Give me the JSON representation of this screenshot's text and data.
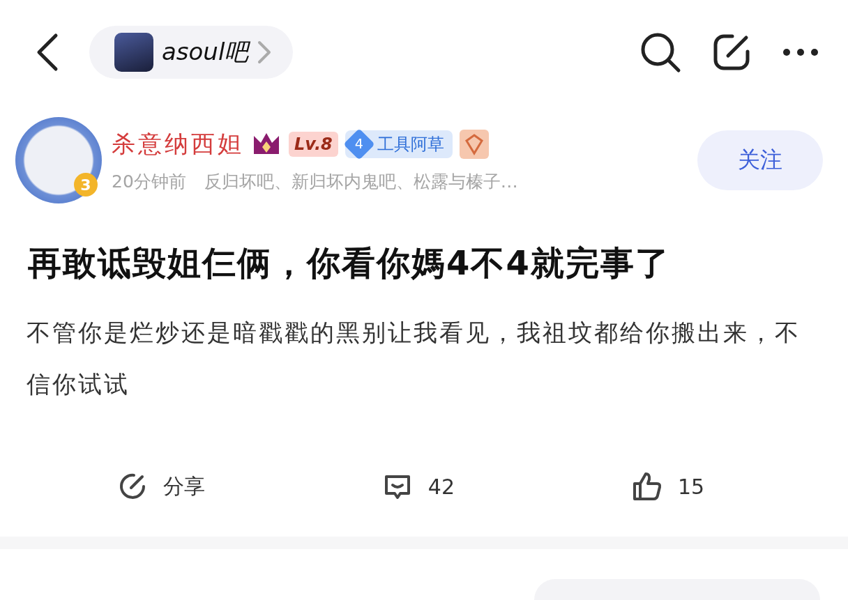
{
  "top_bar": {
    "forum_name": "asoul吧"
  },
  "author": {
    "name": "杀意纳西妲",
    "level": "Lv.8",
    "fan_rank": "4",
    "fan_title": "工具阿草",
    "avatar_badge": "3",
    "time": "20分钟前",
    "forums": "反归坏吧、新归坏内鬼吧、松露与榛子…",
    "follow_label": "关注",
    "followed": false
  },
  "post": {
    "title": "再敢诋毁姐仨俩，你看你媽4不4就完事了",
    "body": "不管你是烂炒还是暗戳戳的黑别让我看见，我祖坟都给你搬出来，不信你试试"
  },
  "actions": [
    {
      "kind": "share",
      "label": "分享"
    },
    {
      "kind": "comment",
      "label": "42"
    },
    {
      "kind": "like",
      "label": "15"
    }
  ]
}
